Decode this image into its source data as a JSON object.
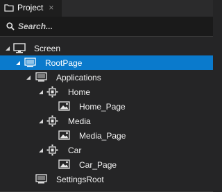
{
  "tab": {
    "label": "Project",
    "close": "×"
  },
  "search": {
    "placeholder": "Search..."
  },
  "tree": [
    {
      "label": "Screen",
      "icon": "monitor-icon",
      "expanded": true
    },
    {
      "label": "RootPage",
      "icon": "page-icon",
      "expanded": true,
      "selected": true
    },
    {
      "label": "Applications",
      "icon": "page-icon",
      "expanded": true
    },
    {
      "label": "Home",
      "icon": "page-host-icon",
      "expanded": true
    },
    {
      "label": "Home_Page",
      "icon": "image-icon"
    },
    {
      "label": "Media",
      "icon": "page-host-icon",
      "expanded": true
    },
    {
      "label": "Media_Page",
      "icon": "image-icon"
    },
    {
      "label": "Car",
      "icon": "page-host-icon",
      "expanded": true
    },
    {
      "label": "Car_Page",
      "icon": "image-icon"
    },
    {
      "label": "SettingsRoot",
      "icon": "page-icon"
    }
  ],
  "colors": {
    "background": "#252526",
    "selection": "#0a7acc",
    "text": "#f2f2f2"
  }
}
